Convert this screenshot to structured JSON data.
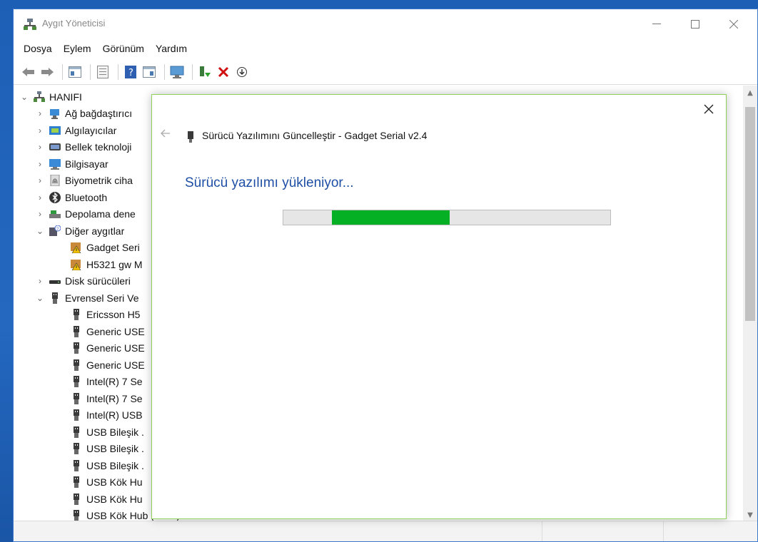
{
  "window": {
    "title": "Aygıt Yöneticisi"
  },
  "menu": [
    "Dosya",
    "Eylem",
    "Görünüm",
    "Yardım"
  ],
  "tree": {
    "root": "HANIFI",
    "items": [
      {
        "label": "Ağ bağdaştırıcı",
        "level": 1,
        "chevron": "right",
        "icon": "network-adapter-icon"
      },
      {
        "label": "Algılayıcılar",
        "level": 1,
        "chevron": "right",
        "icon": "sensor-icon"
      },
      {
        "label": "Bellek teknoloji",
        "level": 1,
        "chevron": "right",
        "icon": "memory-icon"
      },
      {
        "label": "Bilgisayar",
        "level": 1,
        "chevron": "right",
        "icon": "computer-icon"
      },
      {
        "label": "Biyometrik ciha",
        "level": 1,
        "chevron": "right",
        "icon": "fingerprint-icon"
      },
      {
        "label": "Bluetooth",
        "level": 1,
        "chevron": "right",
        "icon": "bluetooth-icon"
      },
      {
        "label": "Depolama dene",
        "level": 1,
        "chevron": "right",
        "icon": "storage-controller-icon"
      },
      {
        "label": "Diğer aygıtlar",
        "level": 1,
        "chevron": "down",
        "icon": "unknown-device-icon"
      },
      {
        "label": "Gadget Seri",
        "level": 2,
        "chevron": "",
        "icon": "warning-device-icon"
      },
      {
        "label": "H5321 gw M",
        "level": 2,
        "chevron": "",
        "icon": "warning-device-icon"
      },
      {
        "label": "Disk sürücüleri",
        "level": 1,
        "chevron": "right",
        "icon": "disk-drive-icon"
      },
      {
        "label": "Evrensel Seri Ve",
        "level": 1,
        "chevron": "down",
        "icon": "usb-icon"
      },
      {
        "label": "Ericsson H5",
        "level": 2,
        "chevron": "",
        "icon": "usb-icon"
      },
      {
        "label": "Generic USE",
        "level": 2,
        "chevron": "",
        "icon": "usb-icon"
      },
      {
        "label": "Generic USE",
        "level": 2,
        "chevron": "",
        "icon": "usb-icon"
      },
      {
        "label": "Generic USE",
        "level": 2,
        "chevron": "",
        "icon": "usb-icon"
      },
      {
        "label": "Intel(R) 7 Se",
        "level": 2,
        "chevron": "",
        "icon": "usb-icon"
      },
      {
        "label": "Intel(R) 7 Se",
        "level": 2,
        "chevron": "",
        "icon": "usb-icon"
      },
      {
        "label": "Intel(R) USB",
        "level": 2,
        "chevron": "",
        "icon": "usb-icon"
      },
      {
        "label": "USB Bileşik .",
        "level": 2,
        "chevron": "",
        "icon": "usb-icon"
      },
      {
        "label": "USB Bileşik .",
        "level": 2,
        "chevron": "",
        "icon": "usb-icon"
      },
      {
        "label": "USB Bileşik .",
        "level": 2,
        "chevron": "",
        "icon": "usb-icon"
      },
      {
        "label": "USB Kök Hu",
        "level": 2,
        "chevron": "",
        "icon": "usb-icon"
      },
      {
        "label": "USB Kök Hu",
        "level": 2,
        "chevron": "",
        "icon": "usb-icon"
      },
      {
        "label": "USB Kök Hub (xHCI)",
        "level": 2,
        "chevron": "",
        "icon": "usb-icon"
      }
    ]
  },
  "dialog": {
    "title": "Sürücü Yazılımını Güncelleştir - Gadget Serial v2.4",
    "heading": "Sürücü yazılımı yükleniyor...",
    "progress_fraction": 0.36,
    "progress_offset_fraction": 0.148,
    "accent_color": "#06b025",
    "heading_color": "#1e4fa5"
  }
}
